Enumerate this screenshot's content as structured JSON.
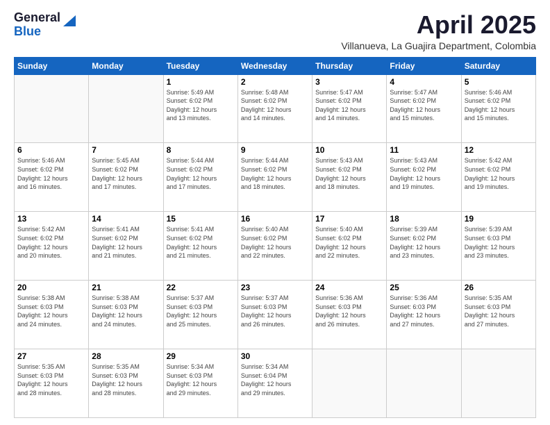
{
  "header": {
    "logo_line1": "General",
    "logo_line2": "Blue",
    "main_title": "April 2025",
    "subtitle": "Villanueva, La Guajira Department, Colombia"
  },
  "days_of_week": [
    "Sunday",
    "Monday",
    "Tuesday",
    "Wednesday",
    "Thursday",
    "Friday",
    "Saturday"
  ],
  "weeks": [
    [
      {
        "day": "",
        "info": ""
      },
      {
        "day": "",
        "info": ""
      },
      {
        "day": "1",
        "info": "Sunrise: 5:49 AM\nSunset: 6:02 PM\nDaylight: 12 hours\nand 13 minutes."
      },
      {
        "day": "2",
        "info": "Sunrise: 5:48 AM\nSunset: 6:02 PM\nDaylight: 12 hours\nand 14 minutes."
      },
      {
        "day": "3",
        "info": "Sunrise: 5:47 AM\nSunset: 6:02 PM\nDaylight: 12 hours\nand 14 minutes."
      },
      {
        "day": "4",
        "info": "Sunrise: 5:47 AM\nSunset: 6:02 PM\nDaylight: 12 hours\nand 15 minutes."
      },
      {
        "day": "5",
        "info": "Sunrise: 5:46 AM\nSunset: 6:02 PM\nDaylight: 12 hours\nand 15 minutes."
      }
    ],
    [
      {
        "day": "6",
        "info": "Sunrise: 5:46 AM\nSunset: 6:02 PM\nDaylight: 12 hours\nand 16 minutes."
      },
      {
        "day": "7",
        "info": "Sunrise: 5:45 AM\nSunset: 6:02 PM\nDaylight: 12 hours\nand 17 minutes."
      },
      {
        "day": "8",
        "info": "Sunrise: 5:44 AM\nSunset: 6:02 PM\nDaylight: 12 hours\nand 17 minutes."
      },
      {
        "day": "9",
        "info": "Sunrise: 5:44 AM\nSunset: 6:02 PM\nDaylight: 12 hours\nand 18 minutes."
      },
      {
        "day": "10",
        "info": "Sunrise: 5:43 AM\nSunset: 6:02 PM\nDaylight: 12 hours\nand 18 minutes."
      },
      {
        "day": "11",
        "info": "Sunrise: 5:43 AM\nSunset: 6:02 PM\nDaylight: 12 hours\nand 19 minutes."
      },
      {
        "day": "12",
        "info": "Sunrise: 5:42 AM\nSunset: 6:02 PM\nDaylight: 12 hours\nand 19 minutes."
      }
    ],
    [
      {
        "day": "13",
        "info": "Sunrise: 5:42 AM\nSunset: 6:02 PM\nDaylight: 12 hours\nand 20 minutes."
      },
      {
        "day": "14",
        "info": "Sunrise: 5:41 AM\nSunset: 6:02 PM\nDaylight: 12 hours\nand 21 minutes."
      },
      {
        "day": "15",
        "info": "Sunrise: 5:41 AM\nSunset: 6:02 PM\nDaylight: 12 hours\nand 21 minutes."
      },
      {
        "day": "16",
        "info": "Sunrise: 5:40 AM\nSunset: 6:02 PM\nDaylight: 12 hours\nand 22 minutes."
      },
      {
        "day": "17",
        "info": "Sunrise: 5:40 AM\nSunset: 6:02 PM\nDaylight: 12 hours\nand 22 minutes."
      },
      {
        "day": "18",
        "info": "Sunrise: 5:39 AM\nSunset: 6:02 PM\nDaylight: 12 hours\nand 23 minutes."
      },
      {
        "day": "19",
        "info": "Sunrise: 5:39 AM\nSunset: 6:03 PM\nDaylight: 12 hours\nand 23 minutes."
      }
    ],
    [
      {
        "day": "20",
        "info": "Sunrise: 5:38 AM\nSunset: 6:03 PM\nDaylight: 12 hours\nand 24 minutes."
      },
      {
        "day": "21",
        "info": "Sunrise: 5:38 AM\nSunset: 6:03 PM\nDaylight: 12 hours\nand 24 minutes."
      },
      {
        "day": "22",
        "info": "Sunrise: 5:37 AM\nSunset: 6:03 PM\nDaylight: 12 hours\nand 25 minutes."
      },
      {
        "day": "23",
        "info": "Sunrise: 5:37 AM\nSunset: 6:03 PM\nDaylight: 12 hours\nand 26 minutes."
      },
      {
        "day": "24",
        "info": "Sunrise: 5:36 AM\nSunset: 6:03 PM\nDaylight: 12 hours\nand 26 minutes."
      },
      {
        "day": "25",
        "info": "Sunrise: 5:36 AM\nSunset: 6:03 PM\nDaylight: 12 hours\nand 27 minutes."
      },
      {
        "day": "26",
        "info": "Sunrise: 5:35 AM\nSunset: 6:03 PM\nDaylight: 12 hours\nand 27 minutes."
      }
    ],
    [
      {
        "day": "27",
        "info": "Sunrise: 5:35 AM\nSunset: 6:03 PM\nDaylight: 12 hours\nand 28 minutes."
      },
      {
        "day": "28",
        "info": "Sunrise: 5:35 AM\nSunset: 6:03 PM\nDaylight: 12 hours\nand 28 minutes."
      },
      {
        "day": "29",
        "info": "Sunrise: 5:34 AM\nSunset: 6:03 PM\nDaylight: 12 hours\nand 29 minutes."
      },
      {
        "day": "30",
        "info": "Sunrise: 5:34 AM\nSunset: 6:04 PM\nDaylight: 12 hours\nand 29 minutes."
      },
      {
        "day": "",
        "info": ""
      },
      {
        "day": "",
        "info": ""
      },
      {
        "day": "",
        "info": ""
      }
    ]
  ]
}
